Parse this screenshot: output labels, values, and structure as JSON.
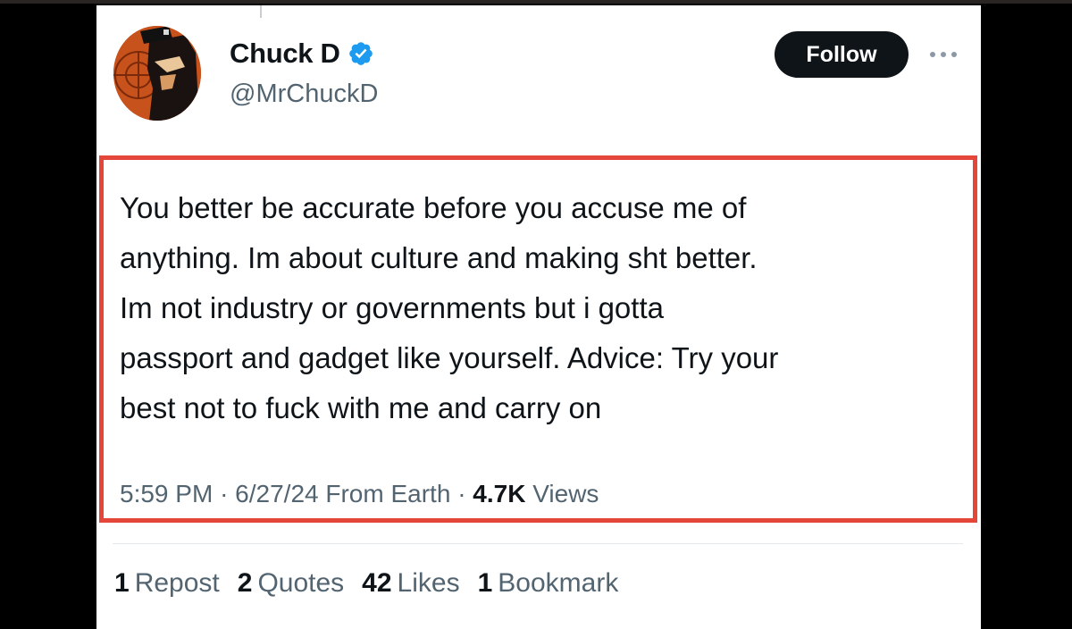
{
  "author": {
    "display_name": "Chuck D",
    "handle": "@MrChuckD",
    "verified": true,
    "avatar_icon": "profile-avatar"
  },
  "actions": {
    "follow_label": "Follow",
    "more_icon": "more-horizontal-icon"
  },
  "tweet": {
    "text": "You better be accurate before you accuse me of\nanything. Im about culture and making sht better.\nIm not industry or governments but i gotta\npassport and gadget like yourself. Advice: Try your\nbest not to fuck with me and carry on",
    "time": "5:59 PM",
    "separator": "·",
    "date": "6/27/24",
    "source": "From Earth",
    "views_count": "4.7K",
    "views_label": "Views"
  },
  "stats": [
    {
      "count": "1",
      "label": "Repost"
    },
    {
      "count": "2",
      "label": "Quotes"
    },
    {
      "count": "42",
      "label": "Likes"
    },
    {
      "count": "1",
      "label": "Bookmark"
    }
  ],
  "colors": {
    "highlight_border": "#e4463a",
    "verified_blue": "#1d9bf0",
    "primary_text": "#0f1419",
    "secondary_text": "#536471",
    "follow_bg": "#0f1419"
  }
}
